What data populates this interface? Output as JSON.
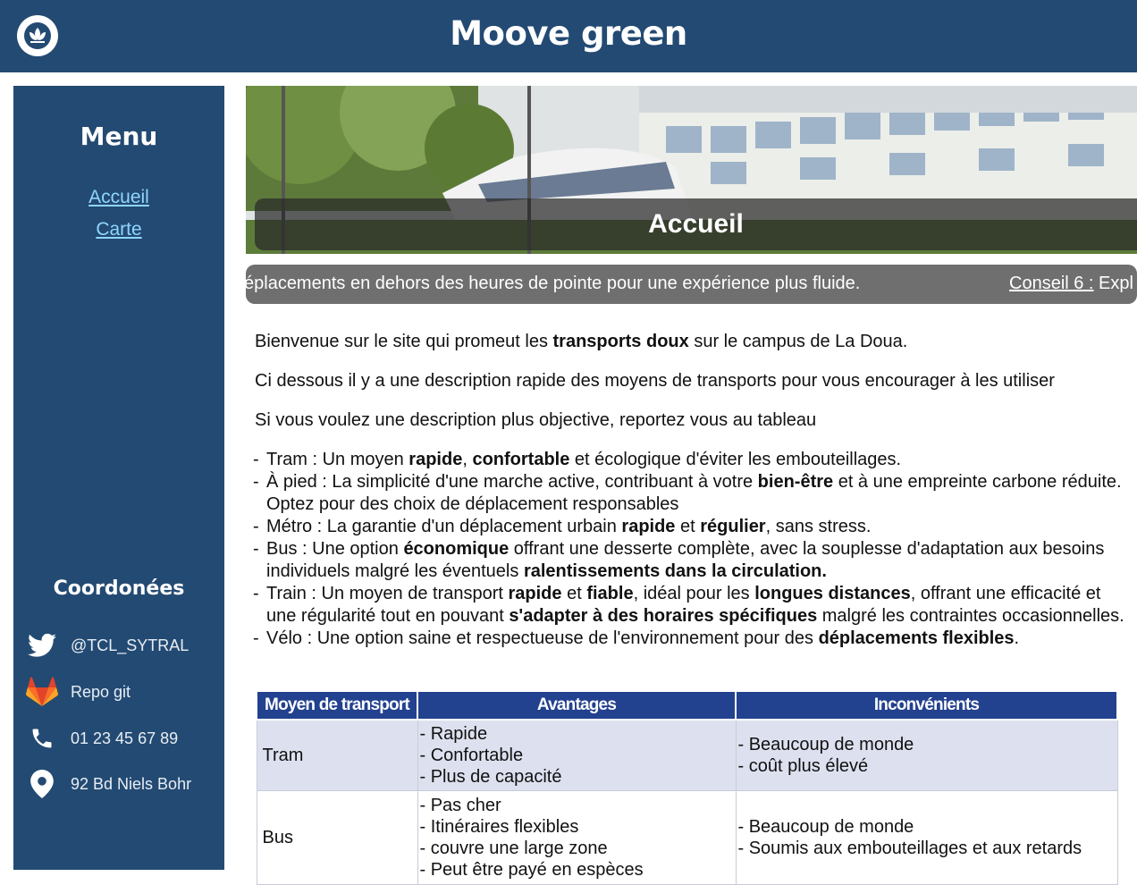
{
  "header": {
    "title": "Moove green",
    "logo_icon": "lotus-icon"
  },
  "sidebar": {
    "menu_title": "Menu",
    "nav": [
      "Accueil",
      "Carte"
    ],
    "contacts_title": "Coordonées",
    "contacts": [
      {
        "icon": "twitter-icon",
        "label": "@TCL_SYTRAL"
      },
      {
        "icon": "gitlab-icon",
        "label": "Repo git"
      },
      {
        "icon": "phone-icon",
        "label": "01 23 45 67 89"
      },
      {
        "icon": "map-pin-icon",
        "label": "92 Bd Niels Bohr"
      }
    ]
  },
  "banner": {
    "caption": "Accueil"
  },
  "ticker": {
    "text": "éplacements en dehors des heures de pointe pour une expérience plus fluide.",
    "next_label": "Conseil 6 :",
    "next_text": " Expl"
  },
  "intro": [
    {
      "a": "Bienvenue sur le site qui promeut les ",
      "b": "transports doux",
      "c": " sur le campus de La Doua."
    },
    {
      "a": "Ci dessous il y a une description rapide des moyens de transports pour vous encourager à les utiliser"
    },
    {
      "a": "Si vous voulez une description plus objective, reportez vous au tableau"
    }
  ],
  "modes": [
    [
      {
        "t": "Tram : Un moyen "
      },
      {
        "t": "rapide",
        "b": true
      },
      {
        "t": ", "
      },
      {
        "t": "confortable",
        "b": true
      },
      {
        "t": " et écologique d'éviter les embouteillages."
      }
    ],
    [
      {
        "t": "À pied : La simplicité d'une marche active, contribuant à votre "
      },
      {
        "t": "bien-être",
        "b": true
      },
      {
        "t": " et à une empreinte carbone réduite. Optez pour des choix de déplacement responsables"
      }
    ],
    [
      {
        "t": "Métro : La garantie d'un déplacement urbain "
      },
      {
        "t": "rapide",
        "b": true
      },
      {
        "t": " et "
      },
      {
        "t": "régulier",
        "b": true
      },
      {
        "t": ", sans stress."
      }
    ],
    [
      {
        "t": "Bus : Une option "
      },
      {
        "t": "économique",
        "b": true
      },
      {
        "t": " offrant une desserte complète, avec la souplesse d'adaptation aux besoins individuels malgré les éventuels "
      },
      {
        "t": "ralentissements dans la circulation.",
        "b": true
      }
    ],
    [
      {
        "t": "Train : Un moyen de transport "
      },
      {
        "t": "rapide",
        "b": true
      },
      {
        "t": " et "
      },
      {
        "t": "fiable",
        "b": true
      },
      {
        "t": ", idéal pour les "
      },
      {
        "t": "longues distances",
        "b": true
      },
      {
        "t": ", offrant une efficacité et une régularité tout en pouvant "
      },
      {
        "t": "s'adapter à des horaires spécifiques",
        "b": true
      },
      {
        "t": " malgré les contraintes occasionnelles."
      }
    ],
    [
      {
        "t": "Vélo : Une option saine et respectueuse de l'environnement pour des "
      },
      {
        "t": "déplacements flexibles",
        "b": true
      },
      {
        "t": "."
      }
    ]
  ],
  "table": {
    "headers": [
      "Moyen de transport",
      "Avantages",
      "Inconvénients"
    ],
    "rows": [
      {
        "mode": "Tram",
        "pros": [
          "Rapide",
          "Confortable",
          "Plus de capacité"
        ],
        "cons": [
          "Beaucoup de monde",
          "coût plus élevé"
        ]
      },
      {
        "mode": "Bus",
        "pros": [
          "Pas cher",
          "Itinéraires flexibles",
          "couvre une large zone",
          "Peut être payé en espèces"
        ],
        "cons": [
          "Beaucoup de monde",
          "Soumis aux embouteillages et aux retards"
        ]
      }
    ]
  },
  "colors": {
    "primary": "#234a72",
    "link": "#8fd6ff",
    "table_header": "#22418f",
    "ticker": "#6f6f6f"
  }
}
